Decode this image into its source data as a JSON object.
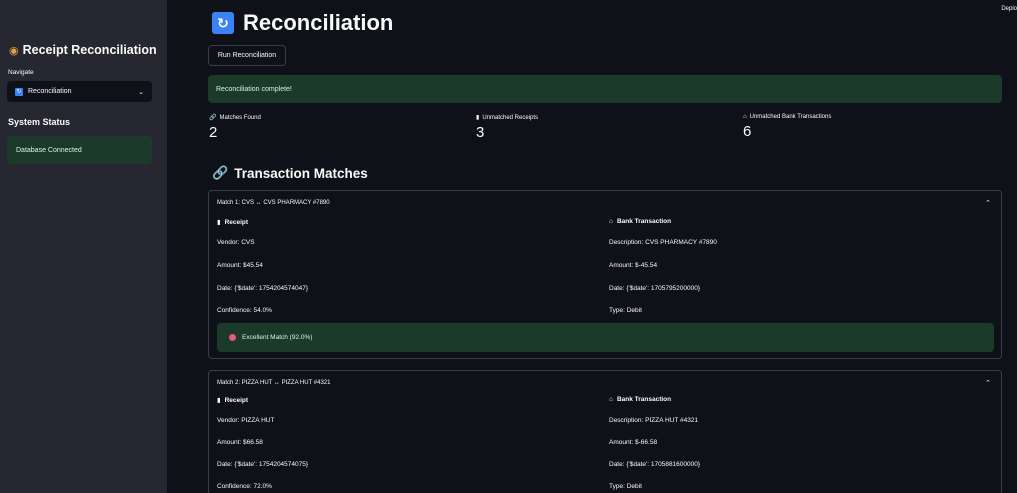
{
  "app": {
    "deploy_label": "Deplo"
  },
  "sidebar": {
    "title": "Receipt Reconciliation",
    "title_icon": "money-bag-icon",
    "navigate_label": "Navigate",
    "select_value": "Reconciliation",
    "system_status_title": "System Status",
    "db_status": "Database Connected"
  },
  "main": {
    "title": "Reconciliation",
    "run_button": "Run Reconciliation",
    "success_message": "Reconciliation complete!",
    "metrics": [
      {
        "label": "Matches Found",
        "value": "2",
        "icon": "link-icon"
      },
      {
        "label": "Unmatched Receipts",
        "value": "3",
        "icon": "document-icon"
      },
      {
        "label": "Unmatched Bank Transactions",
        "value": "6",
        "icon": "bank-icon"
      }
    ],
    "section_title": "Transaction Matches",
    "matches": [
      {
        "header": "Match 1: CVS ↔ CVS PHARMACY #7890",
        "receipt_title": "Receipt",
        "bank_title": "Bank Transaction",
        "receipt": {
          "vendor": "Vendor: CVS",
          "amount": "Amount: $45.54",
          "date": "Date: {'$date': 1754204574047}",
          "confidence": "Confidence: 54.0%"
        },
        "bank": {
          "description": "Description: CVS PHARMACY #7890",
          "amount": "Amount: $-45.54",
          "date": "Date: {'$date': 1705795200000}",
          "type": "Type: Debit"
        },
        "match_quality": "Excellent Match (92.0%)"
      },
      {
        "header": "Match 2: PIZZA HUT ↔ PIZZA HUT #4321",
        "receipt_title": "Receipt",
        "bank_title": "Bank Transaction",
        "receipt": {
          "vendor": "Vendor: PIZZA HUT",
          "amount": "Amount: $66.58",
          "date": "Date: {'$date': 1754204574075}",
          "confidence": "Confidence: 72.0%"
        },
        "bank": {
          "description": "Description: PIZZA HUT #4321",
          "amount": "Amount: $-66.58",
          "date": "Date: {'$date': 1705881600000}",
          "type": "Type: Debit"
        }
      }
    ]
  }
}
